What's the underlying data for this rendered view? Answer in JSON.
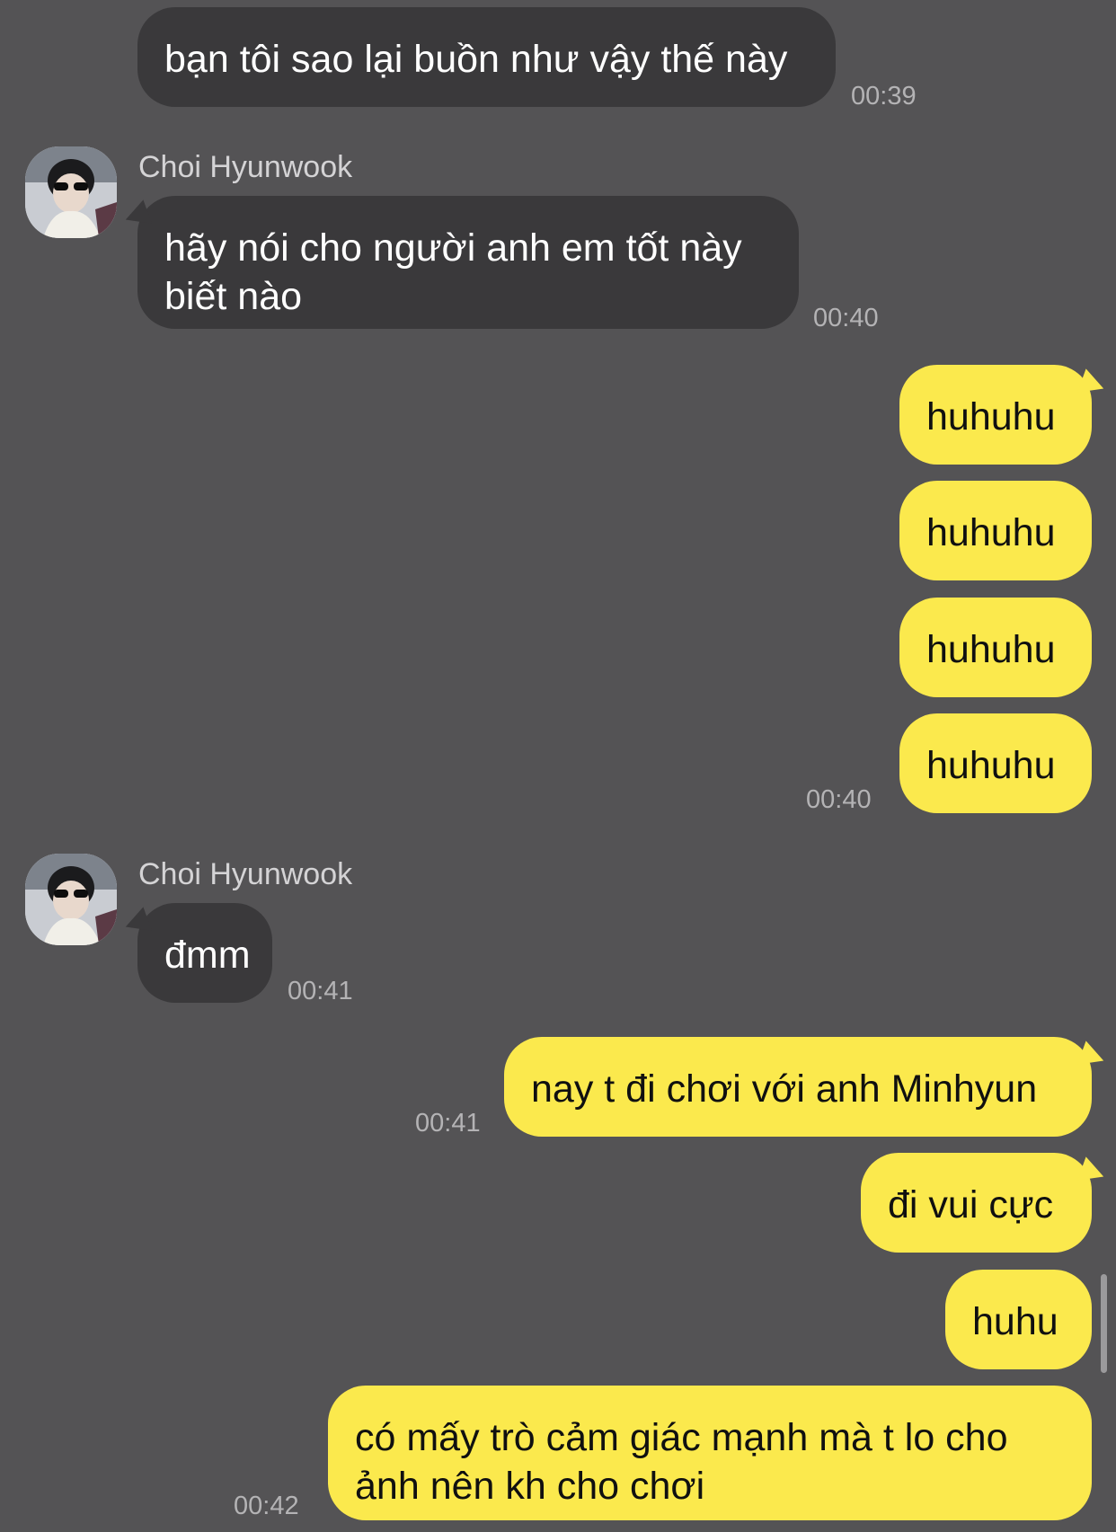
{
  "contact": {
    "name": "Choi Hyunwook"
  },
  "messages": [
    {
      "side": "in",
      "text": "bạn tôi sao lại buồn như vậy thế này",
      "time": "00:39"
    },
    {
      "side": "in",
      "text": "hãy nói cho người anh em tốt này\nbiết nào",
      "time": "00:40"
    },
    {
      "side": "out",
      "text": "huhuhu"
    },
    {
      "side": "out",
      "text": "huhuhu"
    },
    {
      "side": "out",
      "text": "huhuhu"
    },
    {
      "side": "out",
      "text": "huhuhu",
      "time": "00:40"
    },
    {
      "side": "in",
      "text": "đmm",
      "time": "00:41"
    },
    {
      "side": "out",
      "text": "nay t đi chơi với anh Minhyun",
      "time": "00:41"
    },
    {
      "side": "out",
      "text": "đi vui cực"
    },
    {
      "side": "out",
      "text": "huhu"
    },
    {
      "side": "out",
      "text": "có mấy trò cảm giác mạnh mà t lo cho\nảnh nên kh cho chơi",
      "time": "00:42"
    }
  ],
  "colors": {
    "background": "#545355",
    "incoming": "#3a393b",
    "outgoing": "#fbe94d"
  },
  "icons": [
    "avatar"
  ]
}
